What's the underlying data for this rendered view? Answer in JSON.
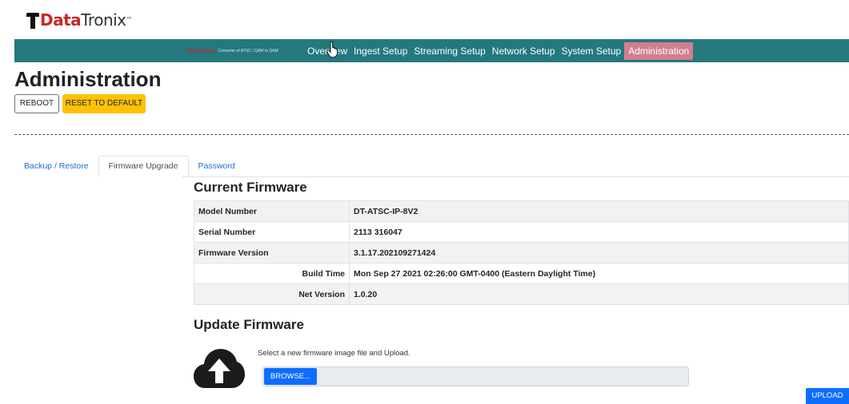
{
  "logo": {
    "bold": "Data",
    "light": "Tronix",
    "tm": "™"
  },
  "navbar": {
    "brand_tagline": "Converter of ATSC / QAM to QAM",
    "items": [
      {
        "label": "Overview",
        "active": false
      },
      {
        "label": "Ingest Setup",
        "active": false
      },
      {
        "label": "Streaming Setup",
        "active": false
      },
      {
        "label": "Network Setup",
        "active": false
      },
      {
        "label": "System Setup",
        "active": false
      },
      {
        "label": "Administration",
        "active": true
      }
    ]
  },
  "page": {
    "title": "Administration",
    "reboot_label": "REBOOT",
    "reset_label": "RESET TO DEFAULT"
  },
  "tabs": [
    {
      "label": "Backup / Restore",
      "active": false
    },
    {
      "label": "Firmware Upgrade",
      "active": true
    },
    {
      "label": "Password",
      "active": false
    }
  ],
  "current_firmware": {
    "heading": "Current Firmware",
    "rows": [
      {
        "label": "Model Number",
        "value": "DT-ATSC-IP-8V2"
      },
      {
        "label": "Serial Number",
        "value": "2113 316047"
      },
      {
        "label": "Firmware Version",
        "value": "3.1.17.202109271424"
      },
      {
        "label": "Build Time",
        "value": "Mon Sep 27 2021 02:26:00 GMT-0400 (Eastern Daylight Time)"
      },
      {
        "label": "Net Version",
        "value": "1.0.20"
      }
    ]
  },
  "update_firmware": {
    "heading": "Update Firmware",
    "hint": "Select a new firmware image file and Upload.",
    "browse_label": "BROWSE...",
    "upload_label": "UPLOAD"
  },
  "colors": {
    "navbar": "#23797e",
    "nav_active": "#d27e91",
    "reset_button": "#ffc107",
    "primary_button": "#0d6efd",
    "brand_red": "#c62828"
  },
  "icons": {
    "cloud": "cloud-upload-icon",
    "cursor": "hand-pointer-icon"
  }
}
